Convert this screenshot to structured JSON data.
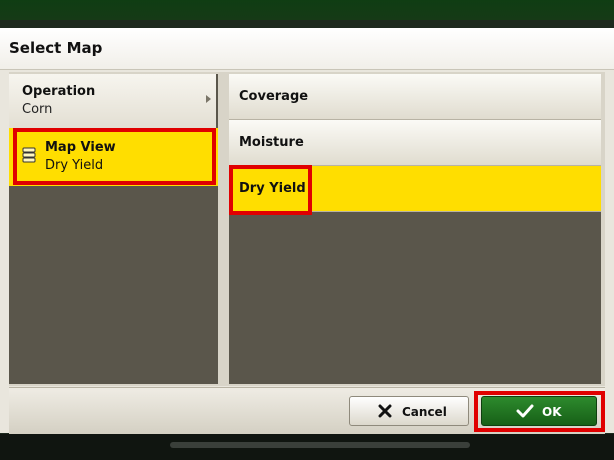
{
  "dialog": {
    "title": "Select Map"
  },
  "left_panel": {
    "operation": {
      "title": "Operation",
      "value": "Corn"
    },
    "map_view": {
      "title": "Map View",
      "value": "Dry Yield",
      "icon": "layers-icon"
    }
  },
  "right_panel": {
    "options": [
      {
        "label": "Coverage",
        "selected": false
      },
      {
        "label": "Moisture",
        "selected": false
      },
      {
        "label": "Dry Yield",
        "selected": true
      }
    ]
  },
  "footer": {
    "cancel_label": "Cancel",
    "ok_label": "OK"
  },
  "colors": {
    "selection": "#ffde00",
    "ok_green": "#1f7a1f",
    "highlight_red": "#e00000",
    "panel_dark": "#5a564b"
  }
}
